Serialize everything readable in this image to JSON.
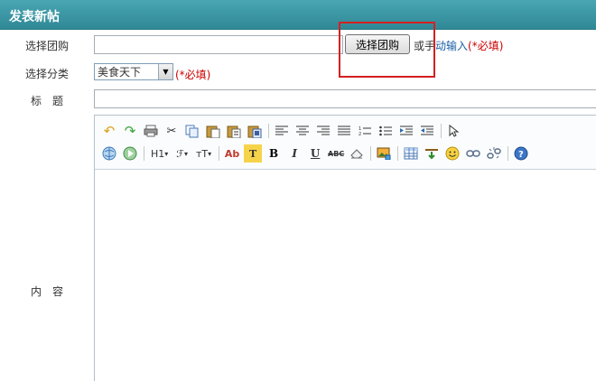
{
  "header": {
    "title": "发表新帖"
  },
  "form": {
    "group_label": "选择团购",
    "group_button": "选择团购",
    "manual_prefix": "或手",
    "manual_link": "动输入",
    "required": "(*必填)",
    "category_label": "选择分类",
    "category_value": "美食天下",
    "title_label": "标　题",
    "content_label": "内　容"
  },
  "toolbar": {
    "heading": "H1",
    "font_family": "ℱ",
    "font_size": "тT",
    "font_color": "Ab",
    "highlight": "T",
    "bold": "B",
    "italic": "I",
    "underline": "U",
    "strike": "ABC"
  },
  "colors": {
    "header_bg": "#3b9aa7",
    "required": "#cc0000",
    "link": "#1a5fa6",
    "highlight_box": "#d42020"
  }
}
